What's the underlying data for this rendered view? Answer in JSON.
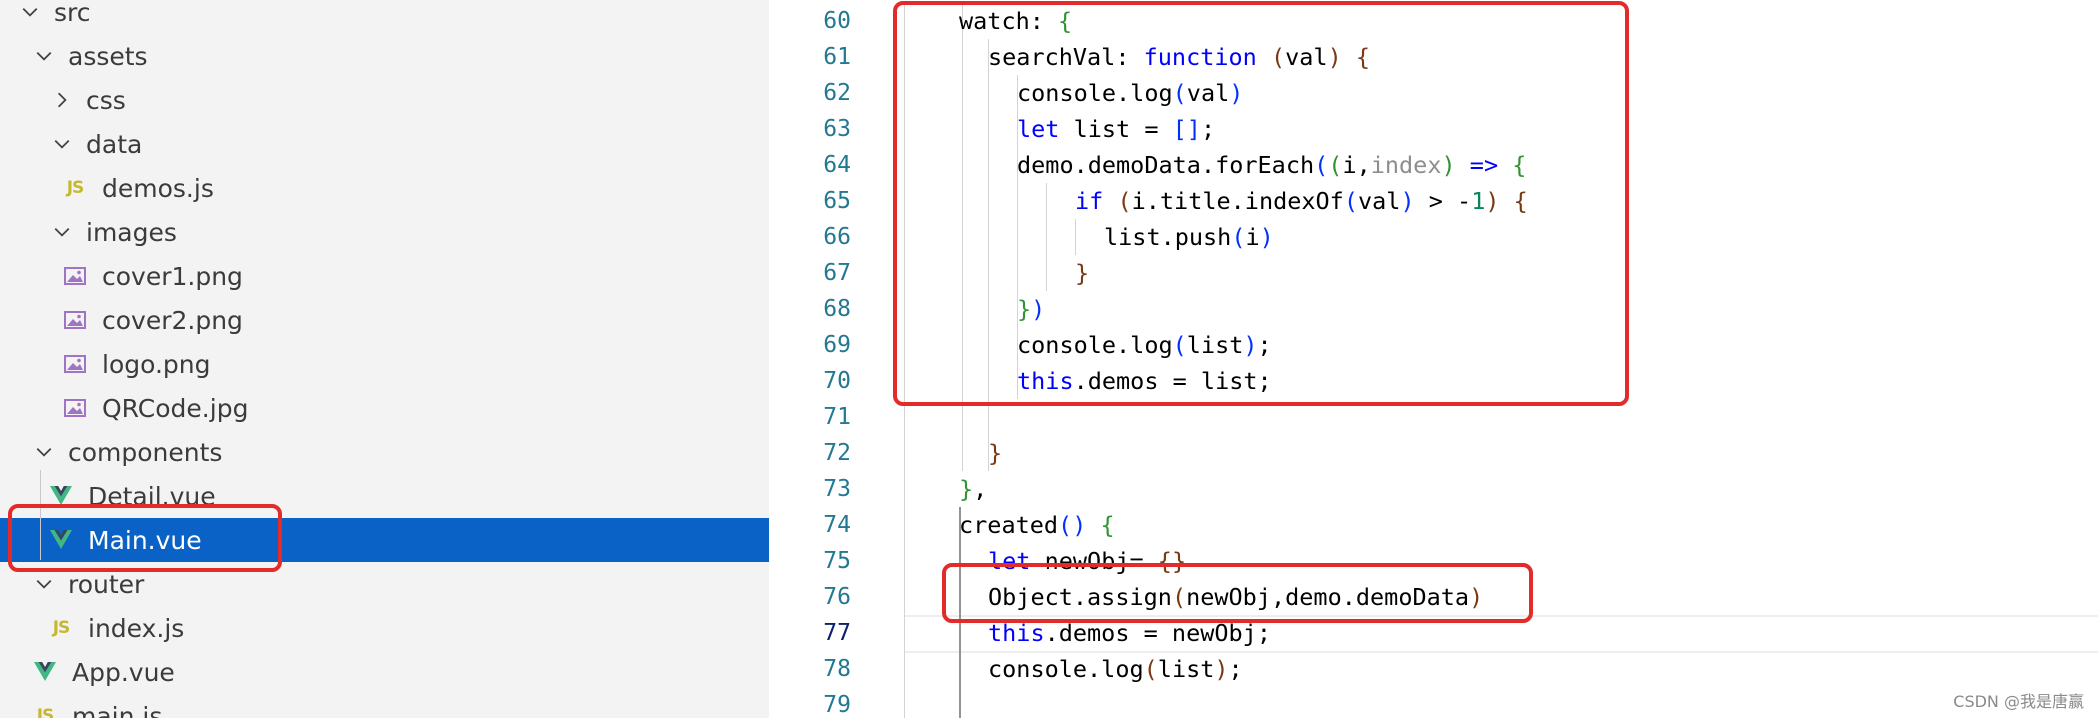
{
  "explorer": {
    "items": [
      {
        "label": "src",
        "type": "folder",
        "expanded": true,
        "depth": 0
      },
      {
        "label": "assets",
        "type": "folder",
        "expanded": true,
        "depth": 1
      },
      {
        "label": "css",
        "type": "folder",
        "expanded": false,
        "depth": 2
      },
      {
        "label": "data",
        "type": "folder",
        "expanded": true,
        "depth": 2
      },
      {
        "label": "demos.js",
        "type": "js",
        "depth": 3
      },
      {
        "label": "images",
        "type": "folder",
        "expanded": true,
        "depth": 2
      },
      {
        "label": "cover1.png",
        "type": "image",
        "depth": 3
      },
      {
        "label": "cover2.png",
        "type": "image",
        "depth": 3
      },
      {
        "label": "logo.png",
        "type": "image",
        "depth": 3
      },
      {
        "label": "QRCode.jpg",
        "type": "image",
        "depth": 3
      },
      {
        "label": "components",
        "type": "folder",
        "expanded": true,
        "depth": 1
      },
      {
        "label": "Detail.vue",
        "type": "vue",
        "depth": 2
      },
      {
        "label": "Main.vue",
        "type": "vue",
        "depth": 2,
        "selected": true
      },
      {
        "label": "router",
        "type": "folder",
        "expanded": true,
        "depth": 1
      },
      {
        "label": "index.js",
        "type": "js",
        "depth": 2
      },
      {
        "label": "App.vue",
        "type": "vue",
        "depth": 1
      },
      {
        "label": "main.js",
        "type": "js",
        "depth": 1
      }
    ],
    "icons": {
      "js": "js-file-icon",
      "vue": "vue-file-icon",
      "image": "image-file-icon",
      "chevron_down": "chevron-down-icon",
      "chevron_right": "chevron-right-icon"
    },
    "selection_color": "#0a62c7"
  },
  "editor": {
    "current_line": 77,
    "lines": [
      {
        "n": "60",
        "indent": 1,
        "tokens": [
          [
            "",
            "watch"
          ],
          [
            "punc",
            ": "
          ],
          [
            "br2",
            "{"
          ]
        ]
      },
      {
        "n": "61",
        "indent": 2,
        "tokens": [
          [
            "",
            "searchVal"
          ],
          [
            "punc",
            ": "
          ],
          [
            "kw",
            "function"
          ],
          [
            "punc",
            " "
          ],
          [
            "br3",
            "("
          ],
          [
            "",
            "val"
          ],
          [
            "br3",
            ")"
          ],
          [
            "punc",
            " "
          ],
          [
            "br3",
            "{"
          ]
        ]
      },
      {
        "n": "62",
        "indent": 3,
        "tokens": [
          [
            "",
            "console.log"
          ],
          [
            "br1",
            "("
          ],
          [
            "",
            "val"
          ],
          [
            "br1",
            ")"
          ]
        ]
      },
      {
        "n": "63",
        "indent": 3,
        "tokens": [
          [
            "kw",
            "let"
          ],
          [
            "punc",
            " list = "
          ],
          [
            "br1",
            "[]"
          ],
          [
            "punc",
            ";"
          ]
        ]
      },
      {
        "n": "64",
        "indent": 3,
        "tokens": [
          [
            "",
            "demo.demoData.forEach"
          ],
          [
            "br1",
            "("
          ],
          [
            "br2",
            "("
          ],
          [
            "",
            "i,"
          ],
          [
            "param-dim",
            "index"
          ],
          [
            "br2",
            ")"
          ],
          [
            "punc",
            " "
          ],
          [
            "kw",
            "=>"
          ],
          [
            "punc",
            " "
          ],
          [
            "br2",
            "{"
          ]
        ]
      },
      {
        "n": "65",
        "indent": 5,
        "tokens": [
          [
            "kw",
            "if"
          ],
          [
            "punc",
            " "
          ],
          [
            "br3",
            "("
          ],
          [
            "",
            "i.title.indexOf"
          ],
          [
            "br1",
            "("
          ],
          [
            "",
            "val"
          ],
          [
            "br1",
            ")"
          ],
          [
            "punc",
            " > -"
          ],
          [
            "num",
            "1"
          ],
          [
            "br3",
            ")"
          ],
          [
            "punc",
            " "
          ],
          [
            "br3",
            "{"
          ]
        ]
      },
      {
        "n": "66",
        "indent": 6,
        "tokens": [
          [
            "",
            "list.push"
          ],
          [
            "br1",
            "("
          ],
          [
            "",
            "i"
          ],
          [
            "br1",
            ")"
          ]
        ]
      },
      {
        "n": "67",
        "indent": 5,
        "tokens": [
          [
            "br3",
            "}"
          ]
        ]
      },
      {
        "n": "68",
        "indent": 3,
        "tokens": [
          [
            "br2",
            "}"
          ],
          [
            "br1",
            ")"
          ]
        ]
      },
      {
        "n": "69",
        "indent": 3,
        "tokens": [
          [
            "",
            "console.log"
          ],
          [
            "br1",
            "("
          ],
          [
            "",
            "list"
          ],
          [
            "br1",
            ")"
          ],
          [
            "punc",
            ";"
          ]
        ]
      },
      {
        "n": "70",
        "indent": 3,
        "tokens": [
          [
            "kw",
            "this"
          ],
          [
            "punc",
            ".demos = list;"
          ]
        ]
      },
      {
        "n": "71",
        "indent": 0,
        "tokens": []
      },
      {
        "n": "72",
        "indent": 2,
        "tokens": [
          [
            "br3",
            "}"
          ]
        ]
      },
      {
        "n": "73",
        "indent": 1,
        "tokens": [
          [
            "br2",
            "}"
          ],
          [
            "punc",
            ","
          ]
        ]
      },
      {
        "n": "74",
        "indent": 1,
        "tokens": [
          [
            "",
            "created"
          ],
          [
            "br1",
            "()"
          ],
          [
            "punc",
            " "
          ],
          [
            "br2",
            "{"
          ]
        ]
      },
      {
        "n": "75",
        "indent": 2,
        "tokens": [
          [
            "kw",
            "let"
          ],
          [
            "punc",
            " newObj= "
          ],
          [
            "br3",
            "{}"
          ]
        ]
      },
      {
        "n": "76",
        "indent": 2,
        "tokens": [
          [
            "",
            "Object.assign"
          ],
          [
            "br3",
            "("
          ],
          [
            "",
            "newObj,demo.demoData"
          ],
          [
            "br3",
            ")"
          ]
        ]
      },
      {
        "n": "77",
        "indent": 2,
        "tokens": [
          [
            "kw",
            "this"
          ],
          [
            "punc",
            ".demos = newObj;"
          ]
        ]
      },
      {
        "n": "78",
        "indent": 2,
        "tokens": [
          [
            "",
            "console.log"
          ],
          [
            "br3",
            "("
          ],
          [
            "",
            "list"
          ],
          [
            "br3",
            ")"
          ],
          [
            "punc",
            ";"
          ]
        ]
      },
      {
        "n": "79",
        "indent": 0,
        "tokens": []
      }
    ],
    "token_colors": {
      "keyword": "#0000ff",
      "bracket_1": "#0431fa",
      "bracket_2": "#319331",
      "bracket_3": "#7b3814",
      "number": "#098658",
      "dimmed_param": "#8e8e8e",
      "line_number": "#237893"
    }
  },
  "annotations": {
    "box_color": "#e22b2b"
  },
  "watermark": "CSDN @我是唐赢"
}
